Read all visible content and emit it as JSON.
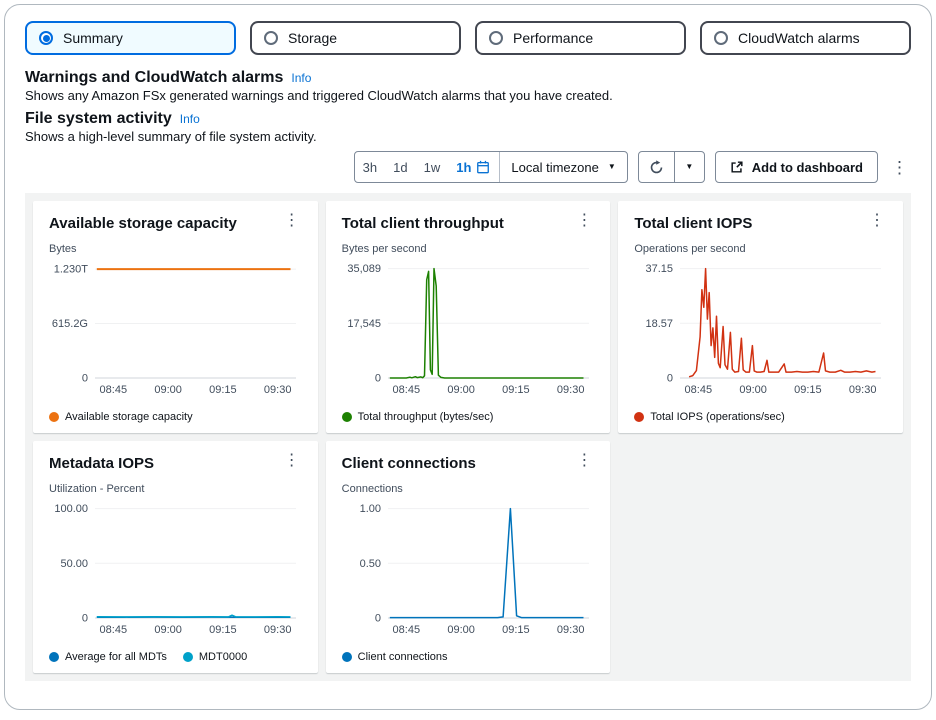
{
  "icons": {
    "caret_down": "▼",
    "kebab_vertical": "⋮"
  },
  "tabs": [
    {
      "label": "Summary",
      "selected": true
    },
    {
      "label": "Storage",
      "selected": false
    },
    {
      "label": "Performance",
      "selected": false
    },
    {
      "label": "CloudWatch alarms",
      "selected": false
    }
  ],
  "warnings_section": {
    "title": "Warnings and CloudWatch alarms",
    "info_label": "Info",
    "description": "Shows any Amazon FSx generated warnings and triggered CloudWatch alarms that you have created."
  },
  "activity_section": {
    "title": "File system activity",
    "info_label": "Info",
    "description": "Shows a high-level summary of file system activity."
  },
  "toolbar": {
    "range_options": [
      "3h",
      "1d",
      "1w"
    ],
    "selected_range": "1h",
    "timezone_label": "Local timezone",
    "add_to_dashboard_label": "Add to dashboard"
  },
  "chart_data": [
    {
      "type": "line",
      "title": "Available storage capacity",
      "unit": "Bytes",
      "x_domain": [
        0,
        55
      ],
      "xticks": [
        {
          "v": 5,
          "label": "08:45"
        },
        {
          "v": 20,
          "label": "09:00"
        },
        {
          "v": 35,
          "label": "09:15"
        },
        {
          "v": 50,
          "label": "09:30"
        }
      ],
      "ymax": 1.31,
      "yticks": [
        {
          "v": 1.23,
          "label": "1.230T"
        },
        {
          "v": 0.6152,
          "label": "615.2G"
        },
        {
          "v": 0,
          "label": "0"
        }
      ],
      "series": [
        {
          "name": "Available storage capacity",
          "color": "#ec7211",
          "width": 2,
          "points": [
            [
              0.5,
              1.23
            ],
            [
              53.5,
              1.23
            ]
          ]
        }
      ]
    },
    {
      "type": "line",
      "title": "Total client throughput",
      "unit": "Bytes per second",
      "x_domain": [
        0,
        55
      ],
      "xticks": [
        {
          "v": 5,
          "label": "08:45"
        },
        {
          "v": 20,
          "label": "09:00"
        },
        {
          "v": 35,
          "label": "09:15"
        },
        {
          "v": 50,
          "label": "09:30"
        }
      ],
      "ymax": 37200,
      "yticks": [
        {
          "v": 35089,
          "label": "35,089"
        },
        {
          "v": 17545,
          "label": "17,545"
        },
        {
          "v": 0,
          "label": "0"
        }
      ],
      "series": [
        {
          "name": "Total throughput (bytes/sec)",
          "color": "#1d8102",
          "width": 1.5,
          "points": [
            [
              0.5,
              0
            ],
            [
              5,
              0
            ],
            [
              6,
              250
            ],
            [
              6.5,
              80
            ],
            [
              7.5,
              420
            ],
            [
              8,
              120
            ],
            [
              9,
              350
            ],
            [
              9.5,
              100
            ],
            [
              10,
              700
            ],
            [
              10.6,
              31500
            ],
            [
              11.1,
              34200
            ],
            [
              11.6,
              2600
            ],
            [
              12.1,
              1200
            ],
            [
              12.6,
              35089
            ],
            [
              13.2,
              29500
            ],
            [
              13.8,
              900
            ],
            [
              14.5,
              180
            ],
            [
              15.5,
              0
            ],
            [
              53.5,
              0
            ]
          ]
        }
      ]
    },
    {
      "type": "line",
      "title": "Total client IOPS",
      "unit": "Operations per second",
      "x_domain": [
        0,
        55
      ],
      "xticks": [
        {
          "v": 5,
          "label": "08:45"
        },
        {
          "v": 20,
          "label": "09:00"
        },
        {
          "v": 35,
          "label": "09:15"
        },
        {
          "v": 50,
          "label": "09:30"
        }
      ],
      "ymax": 39.4,
      "yticks": [
        {
          "v": 37.15,
          "label": "37.15"
        },
        {
          "v": 18.57,
          "label": "18.57"
        },
        {
          "v": 0,
          "label": "0"
        }
      ],
      "series": [
        {
          "name": "Total IOPS (operations/sec)",
          "color": "#d13212",
          "width": 1.5,
          "points": [
            [
              2.5,
              0.4
            ],
            [
              3.5,
              0.8
            ],
            [
              4.5,
              2.5
            ],
            [
              5.5,
              14
            ],
            [
              6,
              30
            ],
            [
              6.5,
              24
            ],
            [
              7,
              37.15
            ],
            [
              7.5,
              20
            ],
            [
              8,
              29
            ],
            [
              8.5,
              11
            ],
            [
              9,
              17
            ],
            [
              9.5,
              7
            ],
            [
              10,
              21
            ],
            [
              10.5,
              5
            ],
            [
              11,
              3.5
            ],
            [
              11.8,
              17.5
            ],
            [
              12.3,
              4.5
            ],
            [
              13,
              3
            ],
            [
              13.8,
              15.5
            ],
            [
              14.3,
              3
            ],
            [
              15,
              2
            ],
            [
              16,
              2.2
            ],
            [
              16.8,
              13.5
            ],
            [
              17.3,
              2.8
            ],
            [
              18,
              2
            ],
            [
              19,
              2
            ],
            [
              19.8,
              11
            ],
            [
              20.3,
              2.4
            ],
            [
              21,
              2
            ],
            [
              22,
              2
            ],
            [
              23,
              2.2
            ],
            [
              23.8,
              6
            ],
            [
              24.3,
              2
            ],
            [
              25.5,
              2
            ],
            [
              27,
              2
            ],
            [
              28.5,
              4.8
            ],
            [
              29,
              2
            ],
            [
              30.5,
              2
            ],
            [
              32,
              2.2
            ],
            [
              33.5,
              2
            ],
            [
              35,
              2
            ],
            [
              36.5,
              2.2
            ],
            [
              38,
              2
            ],
            [
              39.3,
              8.5
            ],
            [
              39.8,
              2.4
            ],
            [
              41,
              2
            ],
            [
              42.5,
              2
            ],
            [
              44,
              2.6
            ],
            [
              45,
              2
            ],
            [
              46.5,
              2
            ],
            [
              48,
              2.2
            ],
            [
              49.5,
              2
            ],
            [
              51,
              2.4
            ],
            [
              52.5,
              2
            ],
            [
              53.5,
              2.2
            ]
          ]
        }
      ]
    },
    {
      "type": "line",
      "title": "Metadata IOPS",
      "unit": "Utilization - Percent",
      "x_domain": [
        0,
        55
      ],
      "xticks": [
        {
          "v": 5,
          "label": "08:45"
        },
        {
          "v": 20,
          "label": "09:00"
        },
        {
          "v": 35,
          "label": "09:15"
        },
        {
          "v": 50,
          "label": "09:30"
        }
      ],
      "ymax": 106,
      "yticks": [
        {
          "v": 100,
          "label": "100.00"
        },
        {
          "v": 50,
          "label": "50.00"
        },
        {
          "v": 0,
          "label": "0"
        }
      ],
      "series": [
        {
          "name": "Average for all MDTs",
          "color": "#0073bb",
          "width": 1.5,
          "points": [
            [
              0.5,
              0.7
            ],
            [
              8,
              0.7
            ],
            [
              16,
              0.8
            ],
            [
              24,
              0.7
            ],
            [
              32,
              0.8
            ],
            [
              40,
              0.7
            ],
            [
              48,
              0.7
            ],
            [
              53.5,
              0.7
            ]
          ]
        },
        {
          "name": "MDT0000",
          "color": "#00a1c9",
          "width": 1.5,
          "points": [
            [
              0.5,
              1.1
            ],
            [
              8,
              1.0
            ],
            [
              16,
              1.2
            ],
            [
              24,
              1.0
            ],
            [
              32,
              1.1
            ],
            [
              36.5,
              1.0
            ],
            [
              37.5,
              2.6
            ],
            [
              38.5,
              1.1
            ],
            [
              44,
              1.0
            ],
            [
              50,
              1.1
            ],
            [
              53.5,
              1.0
            ]
          ]
        }
      ]
    },
    {
      "type": "line",
      "title": "Client connections",
      "unit": "Connections",
      "x_domain": [
        0,
        55
      ],
      "xticks": [
        {
          "v": 5,
          "label": "08:45"
        },
        {
          "v": 20,
          "label": "09:00"
        },
        {
          "v": 35,
          "label": "09:15"
        },
        {
          "v": 50,
          "label": "09:30"
        }
      ],
      "ymax": 1.06,
      "yticks": [
        {
          "v": 1,
          "label": "1.00"
        },
        {
          "v": 0.5,
          "label": "0.50"
        },
        {
          "v": 0,
          "label": "0"
        }
      ],
      "series": [
        {
          "name": "Client connections",
          "color": "#0073bb",
          "width": 1.5,
          "points": [
            [
              0.5,
              0.004
            ],
            [
              30,
              0.004
            ],
            [
              31.5,
              0.01
            ],
            [
              33.5,
              1.0
            ],
            [
              35.2,
              0.02
            ],
            [
              36.5,
              0.004
            ],
            [
              53.5,
              0.004
            ]
          ]
        }
      ]
    }
  ]
}
